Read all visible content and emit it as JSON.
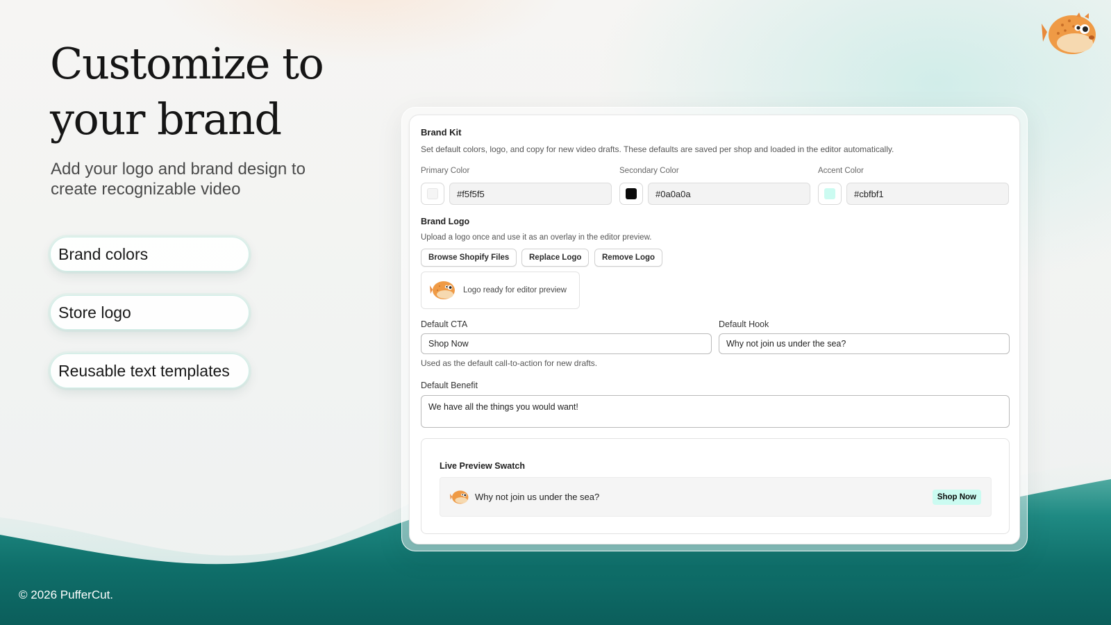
{
  "hero": {
    "title_line1": "Customize to",
    "title_line2": "your brand",
    "subtitle": "Add your logo and brand design to create recognizable video"
  },
  "features": [
    {
      "label": "Brand colors"
    },
    {
      "label": "Store logo"
    },
    {
      "label": "Reusable text templates"
    }
  ],
  "footer": {
    "text": "© 2026 PufferCut."
  },
  "brand_kit": {
    "title": "Brand Kit",
    "description": "Set default colors, logo, and copy for new video drafts. These defaults are saved per shop and loaded in the editor automatically.",
    "colors": [
      {
        "label": "Primary Color",
        "value": "#f5f5f5",
        "swatch": "#f5f5f5"
      },
      {
        "label": "Secondary Color",
        "value": "#0a0a0a",
        "swatch": "#0a0a0a"
      },
      {
        "label": "Accent Color",
        "value": "#cbfbf1",
        "swatch": "#cbfbf1"
      }
    ],
    "logo": {
      "title": "Brand Logo",
      "description": "Upload a logo once and use it as an overlay in the editor preview.",
      "buttons": [
        "Browse Shopify Files",
        "Replace Logo",
        "Remove Logo"
      ],
      "status": "Logo ready for editor preview",
      "icon": "pufferfish-logo-icon"
    },
    "cta": {
      "label": "Default CTA",
      "value": "Shop Now",
      "help": "Used as the default call-to-action for new drafts."
    },
    "hook": {
      "label": "Default Hook",
      "value": "Why not join us under the sea?"
    },
    "benefit": {
      "label": "Default Benefit",
      "value": "We have all the things you would want!"
    },
    "preview": {
      "title": "Live Preview Swatch",
      "hook": "Why not join us under the sea?",
      "cta": "Shop Now"
    }
  },
  "colors": {
    "accent": "#cbfbf1",
    "sea_dark": "#0e6f6a",
    "mascot_orange": "#e8893a"
  }
}
